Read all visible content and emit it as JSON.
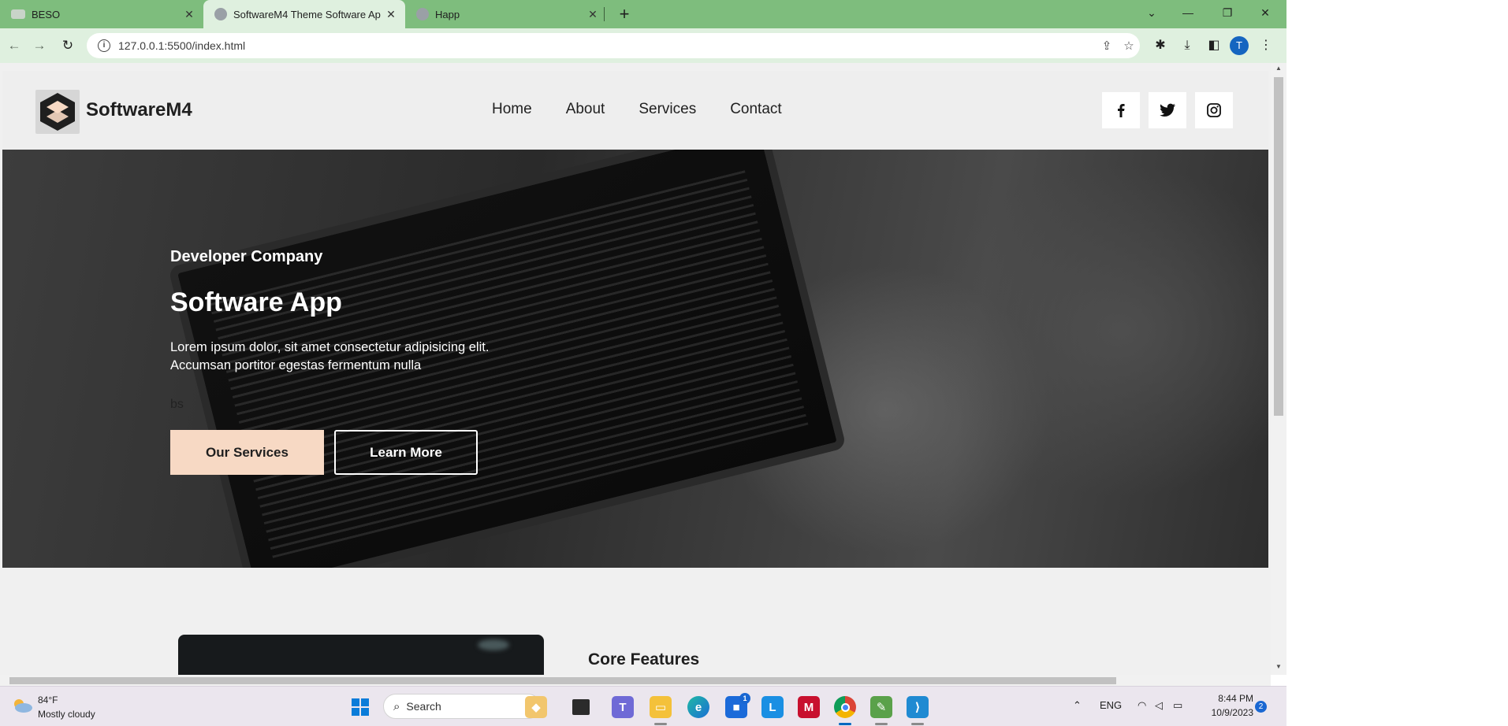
{
  "browser": {
    "tabs": [
      {
        "title": "BESO",
        "active": false
      },
      {
        "title": "SoftwareM4 Theme Software Ap",
        "active": true
      },
      {
        "title": "Happ",
        "active": false
      }
    ],
    "new_tab_label": "+",
    "url": "127.0.0.1:5500/index.html",
    "profile_initial": "T",
    "window_controls": {
      "minimize": "—",
      "maximize": "❐",
      "close": "✕",
      "tab_search": "⌄"
    }
  },
  "site": {
    "brand": "SoftwareM4",
    "nav": [
      "Home",
      "About",
      "Services",
      "Contact"
    ],
    "social_icons": [
      "facebook-icon",
      "twitter-icon",
      "instagram-icon"
    ],
    "hero": {
      "subtitle": "Developer Company",
      "title": "Software App",
      "description": "Lorem ipsum dolor, sit amet consectetur adipisicing elit. Accumsan portitor egestas fermentum nulla",
      "stray_text": "bs",
      "primary_button": "Our Services",
      "secondary_button": "Learn More"
    },
    "section2": {
      "title": "Core Features"
    },
    "colors": {
      "accent": "#f7d9c4",
      "header_bg": "#eeeeee",
      "tabstrip": "#7ebd7d"
    }
  },
  "taskbar": {
    "weather": {
      "temp": "84°F",
      "desc": "Mostly cloudy"
    },
    "search_label": "Search",
    "apps": [
      "widgets-icon",
      "task-view-icon",
      "teams-icon",
      "file-explorer-icon",
      "edge-icon",
      "microsoft-store-icon",
      "l-app-icon",
      "mcafee-icon",
      "chrome-icon",
      "game-icon",
      "vscode-icon"
    ],
    "store_badge": "1",
    "language": "ENG",
    "time": "8:44 PM",
    "date": "10/9/2023",
    "notification_count": "2"
  }
}
